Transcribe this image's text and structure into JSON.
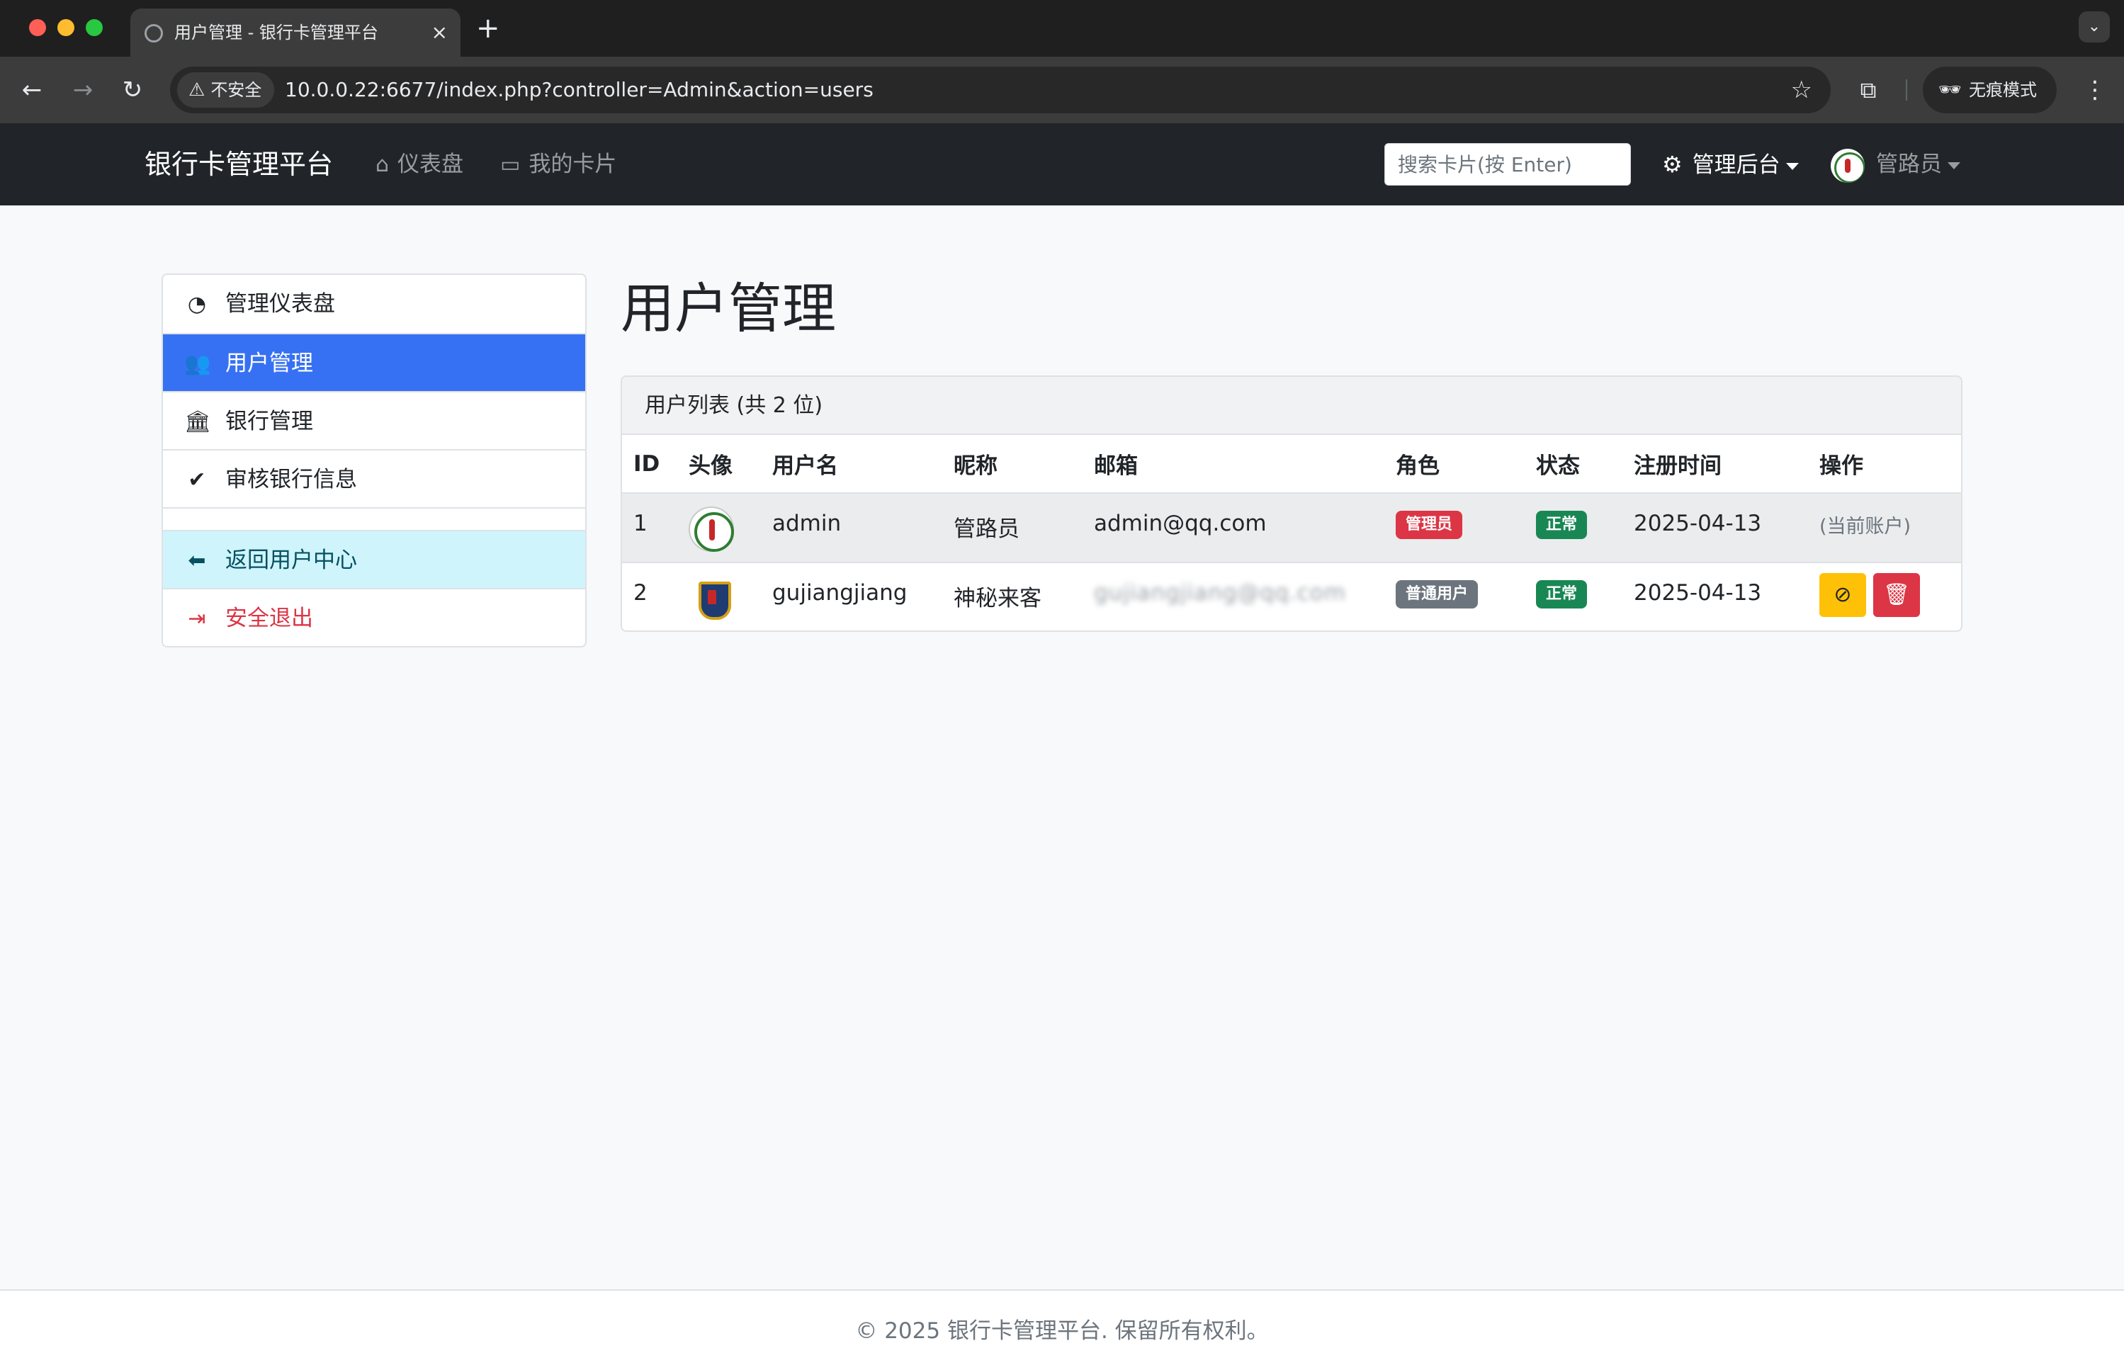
{
  "browser": {
    "tab_title": "用户管理 - 银行卡管理平台",
    "tab_close": "×",
    "new_tab": "+",
    "tab_menu": "⌄",
    "security_label": "不安全",
    "url": "10.0.0.22:6677/index.php?controller=Admin&action=users",
    "incognito_label": "无痕模式"
  },
  "navbar": {
    "brand": "银行卡管理平台",
    "links": [
      {
        "label": "仪表盘",
        "icon": "home-icon"
      },
      {
        "label": "我的卡片",
        "icon": "card-icon"
      }
    ],
    "search_placeholder": "搜索卡片(按 Enter)",
    "admin_menu": "管理后台",
    "user_menu": "管路员"
  },
  "sidebar": {
    "items": [
      {
        "label": "管理仪表盘",
        "icon": "speedometer-icon"
      },
      {
        "label": "用户管理",
        "icon": "users-icon",
        "active": true
      },
      {
        "label": "银行管理",
        "icon": "bank-icon"
      },
      {
        "label": "审核银行信息",
        "icon": "verified-badge-icon"
      }
    ],
    "bottom_items": [
      {
        "label": "返回用户中心",
        "icon": "arrow-left-circle-icon"
      },
      {
        "label": "安全退出",
        "icon": "logout-icon"
      }
    ]
  },
  "main": {
    "title": "用户管理",
    "card_header": "用户列表 (共 2 位)",
    "columns": [
      "ID",
      "头像",
      "用户名",
      "昵称",
      "邮箱",
      "角色",
      "状态",
      "注册时间",
      "操作"
    ],
    "rows": [
      {
        "id": "1",
        "username": "admin",
        "nickname": "管路员",
        "email": "admin@qq.com",
        "role": "管理员",
        "status": "正常",
        "registered": "2025-04-13",
        "action_text": "(当前账户)"
      },
      {
        "id": "2",
        "username": "gujiangjiang",
        "nickname": "神秘来客",
        "email": "gujiangjiang@qq.com",
        "role": "普通用户",
        "status": "正常",
        "registered": "2025-04-13"
      }
    ]
  },
  "footer": {
    "text": "© 2025 银行卡管理平台. 保留所有权利。"
  },
  "colors": {
    "primary": "#3771f3",
    "danger": "#dc3545",
    "success": "#198754",
    "warning": "#ffc107",
    "secondary": "#6c757d",
    "navbar_bg": "#212529",
    "info_bg": "#cff4fc"
  }
}
